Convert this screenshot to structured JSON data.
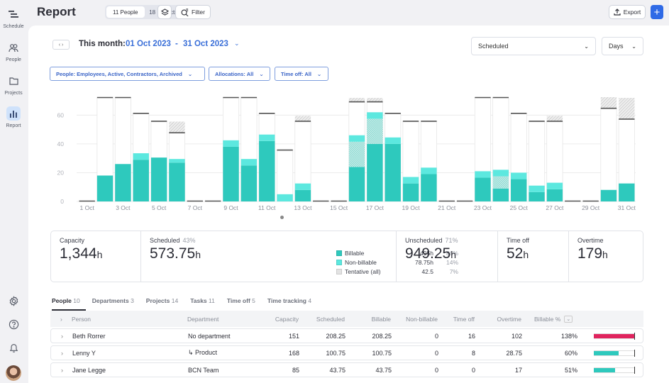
{
  "sidebar": {
    "items": [
      {
        "label": "Schedule",
        "icon": "schedule-icon"
      },
      {
        "label": "People",
        "icon": "people-icon"
      },
      {
        "label": "Projects",
        "icon": "folder-icon"
      },
      {
        "label": "Report",
        "icon": "bar-chart-icon",
        "active": true
      }
    ],
    "bottom_icons": [
      "gear-icon",
      "help-icon",
      "bell-icon",
      "avatar"
    ]
  },
  "header": {
    "title": "Report",
    "toggle": [
      "11 People",
      "18 Projects"
    ],
    "toggle_active": 0,
    "filter_label": "Filter",
    "export_label": "Export",
    "add_label": "+"
  },
  "toolbar": {
    "prev_next": "‹ ›",
    "period_label": "This month:",
    "date_from": "01 Oct 2023",
    "date_sep": "-",
    "date_to": "31 Oct 2023",
    "metric_select": "Scheduled",
    "unit_select": "Days",
    "filters": [
      "People: Employees, Active, Contractors, Archived",
      "Allocations: All",
      "Time off: All"
    ]
  },
  "chart_data": {
    "type": "bar",
    "stacked": true,
    "title": "",
    "xlabel": "",
    "ylabel": "",
    "ylim": [
      0,
      72
    ],
    "yticks": [
      0,
      20,
      40,
      60
    ],
    "grid": true,
    "colors": {
      "billable": "#2ec9bd",
      "non_billable": "#5ce8df",
      "tentative": "#a9ddd8",
      "capacity_line": "#555555",
      "time_off": "#cfcfcf"
    },
    "categories": [
      "1 Oct",
      "2 Oct",
      "3 Oct",
      "4 Oct",
      "5 Oct",
      "6 Oct",
      "7 Oct",
      "8 Oct",
      "9 Oct",
      "10 Oct",
      "11 Oct",
      "12 Oct",
      "13 Oct",
      "14 Oct",
      "15 Oct",
      "16 Oct",
      "17 Oct",
      "18 Oct",
      "19 Oct",
      "20 Oct",
      "21 Oct",
      "22 Oct",
      "23 Oct",
      "24 Oct",
      "25 Oct",
      "26 Oct",
      "27 Oct",
      "28 Oct",
      "29 Oct",
      "30 Oct",
      "31 Oct"
    ],
    "tick_labels": [
      "1 Oct",
      "",
      "3 Oct",
      "",
      "5 Oct",
      "",
      "7 Oct",
      "",
      "9 Oct",
      "",
      "11 Oct",
      "",
      "13 Oct",
      "",
      "15 Oct",
      "",
      "17 Oct",
      "",
      "19 Oct",
      "",
      "21 Oct",
      "",
      "23 Oct",
      "",
      "25 Oct",
      "",
      "27 Oct",
      "",
      "29 Oct",
      "",
      "31 Oct"
    ],
    "series": [
      {
        "name": "Billable",
        "values": [
          0,
          18,
          26,
          29,
          30.5,
          27,
          0,
          0,
          38,
          25,
          42,
          0,
          8,
          0,
          0,
          24,
          40,
          40,
          12.5,
          19,
          0,
          0,
          16.5,
          9,
          15.5,
          6.5,
          8.5,
          0,
          0,
          8,
          12.5
        ]
      },
      {
        "name": "Non-billable",
        "values": [
          0,
          0,
          0,
          4.5,
          0,
          2.5,
          0,
          0,
          4.5,
          4.5,
          4.5,
          5,
          4.5,
          0,
          0,
          4.5,
          4.5,
          4.5,
          4.5,
          4.5,
          0,
          0,
          4.5,
          4.5,
          4.5,
          4.5,
          4.5,
          0,
          0,
          0,
          0
        ]
      },
      {
        "name": "Tentative",
        "values": [
          0,
          0,
          0,
          0,
          0,
          0,
          0,
          0,
          0,
          0,
          0,
          0,
          0,
          0,
          0,
          17.5,
          17.5,
          0,
          0,
          0,
          0,
          0,
          0,
          8.5,
          0,
          0,
          0,
          0,
          0,
          0,
          0
        ]
      },
      {
        "name": "Capacity",
        "values": [
          0,
          72,
          72,
          61,
          55.5,
          47.5,
          0,
          0,
          72,
          72,
          61,
          35.5,
          55.5,
          0,
          0,
          69,
          69,
          61,
          55.5,
          55.5,
          0,
          0,
          72,
          72,
          61,
          55.5,
          55.5,
          0,
          0,
          64.5,
          57
        ]
      },
      {
        "name": "Time off",
        "values": [
          0,
          0,
          0,
          0,
          0,
          8,
          0,
          0,
          0,
          0,
          0,
          0,
          4,
          0,
          0,
          3,
          3,
          0,
          0,
          0,
          0,
          0,
          0,
          0,
          0,
          0,
          4,
          0,
          0,
          8,
          15
        ]
      }
    ]
  },
  "pagination_dot": "•",
  "summary": {
    "capacity": {
      "label": "Capacity",
      "value": "1,344",
      "unit": "h"
    },
    "scheduled": {
      "label": "Scheduled",
      "pct": "43%",
      "value": "573.75",
      "unit": "h",
      "legend": [
        {
          "name": "Billable",
          "hours": "495h",
          "pct": "86%",
          "color": "#2ec9bd"
        },
        {
          "name": "Non-billable",
          "hours": "78.75h",
          "pct": "14%",
          "color": "#5ce8df"
        },
        {
          "name": "Tentative (all)",
          "hours": "42.5",
          "pct": "7%",
          "color": "#e3e3e3"
        }
      ]
    },
    "unscheduled": {
      "label": "Unscheduled",
      "pct": "71%",
      "value": "949.25",
      "unit": "h"
    },
    "time_off": {
      "label": "Time off",
      "value": "52",
      "unit": "h"
    },
    "overtime": {
      "label": "Overtime",
      "value": "179",
      "unit": "h"
    }
  },
  "tabs": [
    {
      "label": "People",
      "count": "10",
      "active": true
    },
    {
      "label": "Departments",
      "count": "3"
    },
    {
      "label": "Projects",
      "count": "14"
    },
    {
      "label": "Tasks",
      "count": "11"
    },
    {
      "label": "Time off",
      "count": "5"
    },
    {
      "label": "Time tracking",
      "count": "4"
    }
  ],
  "table": {
    "columns": [
      "Person",
      "Department",
      "Capacity",
      "Scheduled",
      "Billable",
      "Non-billable",
      "Time off",
      "Overtime",
      "Billable %"
    ],
    "rows": [
      {
        "person": "Beth Rorrer",
        "department": "No department",
        "capacity": "151",
        "scheduled": "208.25",
        "billable": "208.25",
        "non_billable": "0",
        "time_off": "16",
        "overtime": "102",
        "billable_pct": "138%",
        "pct_value": 1.38,
        "bar_color": "#e0245e"
      },
      {
        "person": "Lenny Y",
        "department": "↳ Product",
        "capacity": "168",
        "scheduled": "100.75",
        "billable": "100.75",
        "non_billable": "0",
        "time_off": "8",
        "overtime": "28.75",
        "billable_pct": "60%",
        "pct_value": 0.6,
        "bar_color": "#2ec9bd"
      },
      {
        "person": "Jane Legge",
        "department": "BCN Team",
        "capacity": "85",
        "scheduled": "43.75",
        "billable": "43.75",
        "non_billable": "0",
        "time_off": "0",
        "overtime": "17",
        "billable_pct": "51%",
        "pct_value": 0.51,
        "bar_color": "#2ec9bd"
      }
    ]
  }
}
